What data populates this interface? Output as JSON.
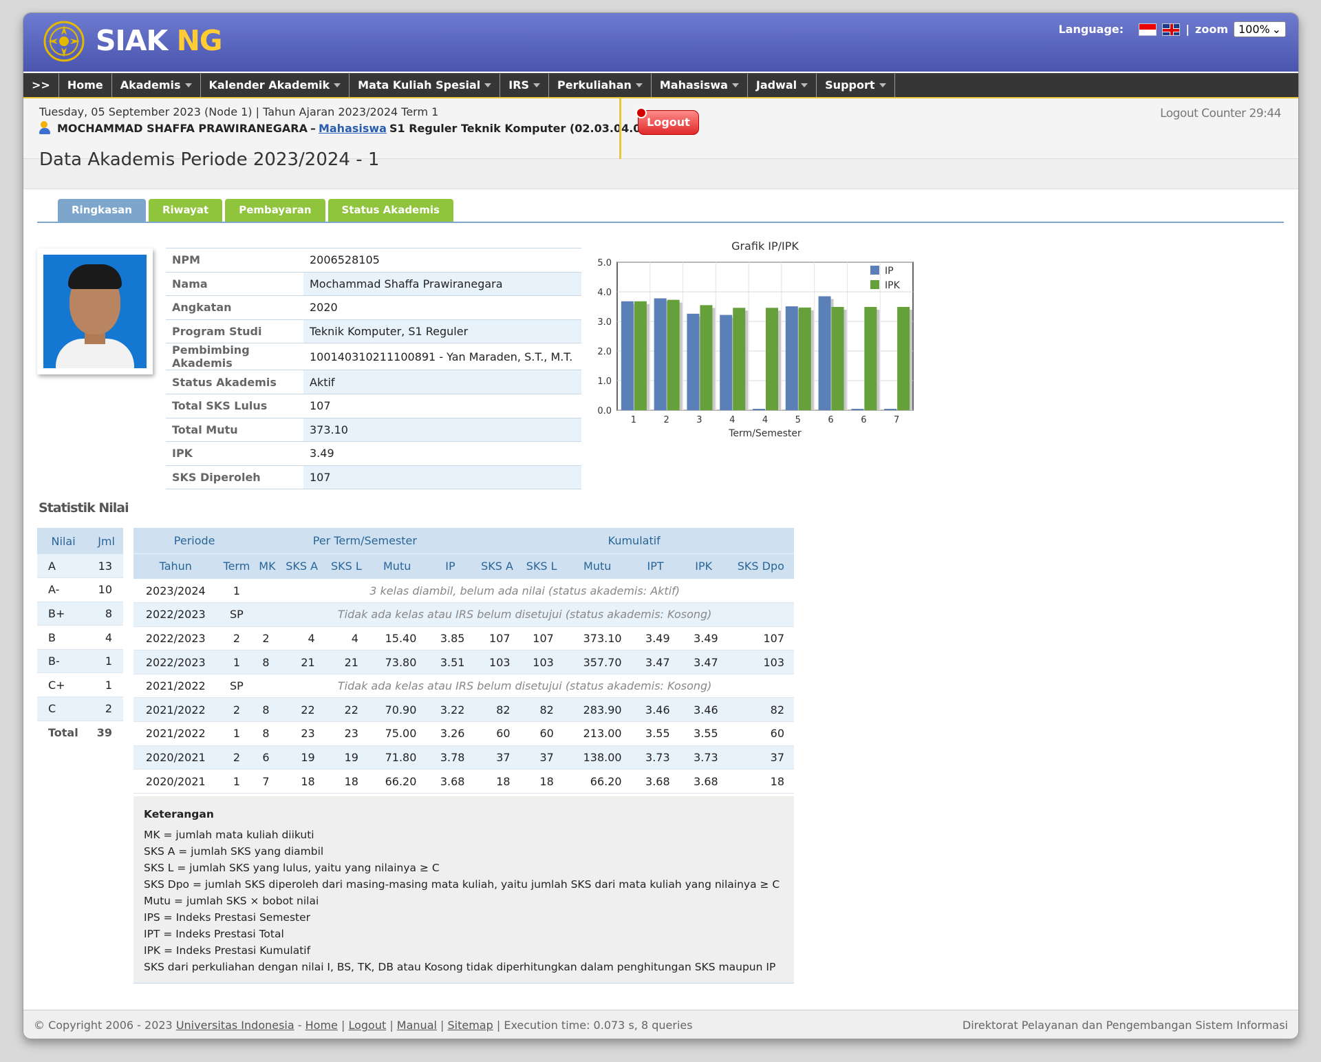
{
  "header": {
    "logo_main": "SIAK",
    "logo_accent": "NG",
    "language_label": "Language:",
    "zoom_label": "zoom",
    "zoom_value": "100%"
  },
  "menu": [
    {
      "label": ">>",
      "dropdown": false
    },
    {
      "label": "Home",
      "dropdown": false
    },
    {
      "label": "Akademis",
      "dropdown": true
    },
    {
      "label": "Kalender Akademik",
      "dropdown": true
    },
    {
      "label": "Mata Kuliah Spesial",
      "dropdown": true
    },
    {
      "label": "IRS",
      "dropdown": true
    },
    {
      "label": "Perkuliahan",
      "dropdown": true
    },
    {
      "label": "Mahasiswa",
      "dropdown": true
    },
    {
      "label": "Jadwal",
      "dropdown": true
    },
    {
      "label": "Support",
      "dropdown": true
    }
  ],
  "session": {
    "date_line": "Tuesday, 05 September 2023 (Node 1) | Tahun Ajaran 2023/2024 Term 1",
    "user_name": "MOCHAMMAD SHAFFA PRAWIRANEGARA",
    "separator": "–",
    "role_link": "Mahasiswa",
    "program": "S1 Reguler Teknik Komputer (02.03.04.01)",
    "logout_label": "Logout",
    "logout_counter": "Logout Counter 29:44"
  },
  "page_title": "Data Akademis Periode 2023/2024 - 1",
  "tabs": [
    "Ringkasan",
    "Riwayat",
    "Pembayaran",
    "Status Akademis"
  ],
  "profile": [
    {
      "key": "NPM",
      "value": "2006528105"
    },
    {
      "key": "Nama",
      "value": "Mochammad Shaffa Prawiranegara"
    },
    {
      "key": "Angkatan",
      "value": "2020"
    },
    {
      "key": "Program Studi",
      "value": "Teknik Komputer, S1 Reguler"
    },
    {
      "key": "Pembimbing Akademis",
      "value": "100140310211100891 - Yan Maraden, S.T., M.T."
    },
    {
      "key": "Status Akademis",
      "value": "Aktif"
    },
    {
      "key": "Total SKS Lulus",
      "value": "107"
    },
    {
      "key": "Total Mutu",
      "value": "373.10"
    },
    {
      "key": "IPK",
      "value": "3.49"
    },
    {
      "key": "SKS Diperoleh",
      "value": "107"
    }
  ],
  "chart_data": {
    "type": "bar",
    "title": "Grafik IP/IPK",
    "xlabel": "Term/Semester",
    "ylabel": "",
    "ylim": [
      0,
      5
    ],
    "yticks": [
      "0.0",
      "1.0",
      "2.0",
      "3.0",
      "4.0",
      "5.0"
    ],
    "categories": [
      "1",
      "2",
      "3",
      "4",
      "4",
      "5",
      "6",
      "6",
      "7"
    ],
    "series": [
      {
        "name": "IP",
        "color": "#5b80b8",
        "values": [
          3.68,
          3.78,
          3.26,
          3.22,
          0,
          3.51,
          3.85,
          0,
          0
        ]
      },
      {
        "name": "IPK",
        "color": "#66a03a",
        "values": [
          3.68,
          3.73,
          3.55,
          3.46,
          3.46,
          3.47,
          3.49,
          3.49,
          3.49
        ]
      }
    ],
    "legend": "top-right",
    "grid": true
  },
  "statistik": {
    "title": "Statistik Nilai",
    "nilai_headers": [
      "Nilai",
      "Jml"
    ],
    "nilai_rows": [
      {
        "nilai": "A",
        "jml": "13"
      },
      {
        "nilai": "A-",
        "jml": "10"
      },
      {
        "nilai": "B+",
        "jml": "8"
      },
      {
        "nilai": "B",
        "jml": "4"
      },
      {
        "nilai": "B-",
        "jml": "1"
      },
      {
        "nilai": "C+",
        "jml": "1"
      },
      {
        "nilai": "C",
        "jml": "2"
      }
    ],
    "nilai_total_label": "Total",
    "nilai_total": "39",
    "group_headers": [
      "Periode",
      "Per Term/Semester",
      "Kumulatif"
    ],
    "col_headers": [
      "Tahun",
      "Term",
      "MK",
      "SKS A",
      "SKS L",
      "Mutu",
      "IP",
      "SKS A",
      "SKS L",
      "Mutu",
      "IPT",
      "IPK",
      "SKS Dpo"
    ],
    "rows": [
      {
        "tahun": "2023/2024",
        "term": "1",
        "note": "3 kelas diambil, belum ada nilai (status akademis: Aktif)"
      },
      {
        "tahun": "2022/2023",
        "term": "SP",
        "note": "Tidak ada kelas atau IRS belum disetujui (status akademis: Kosong)"
      },
      {
        "tahun": "2022/2023",
        "term": "2",
        "cells": [
          "2",
          "4",
          "4",
          "15.40",
          "3.85",
          "107",
          "107",
          "373.10",
          "3.49",
          "3.49",
          "107"
        ]
      },
      {
        "tahun": "2022/2023",
        "term": "1",
        "cells": [
          "8",
          "21",
          "21",
          "73.80",
          "3.51",
          "103",
          "103",
          "357.70",
          "3.47",
          "3.47",
          "103"
        ]
      },
      {
        "tahun": "2021/2022",
        "term": "SP",
        "note": "Tidak ada kelas atau IRS belum disetujui (status akademis: Kosong)"
      },
      {
        "tahun": "2021/2022",
        "term": "2",
        "cells": [
          "8",
          "22",
          "22",
          "70.90",
          "3.22",
          "82",
          "82",
          "283.90",
          "3.46",
          "3.46",
          "82"
        ]
      },
      {
        "tahun": "2021/2022",
        "term": "1",
        "cells": [
          "8",
          "23",
          "23",
          "75.00",
          "3.26",
          "60",
          "60",
          "213.00",
          "3.55",
          "3.55",
          "60"
        ]
      },
      {
        "tahun": "2020/2021",
        "term": "2",
        "cells": [
          "6",
          "19",
          "19",
          "71.80",
          "3.78",
          "37",
          "37",
          "138.00",
          "3.73",
          "3.73",
          "37"
        ]
      },
      {
        "tahun": "2020/2021",
        "term": "1",
        "cells": [
          "7",
          "18",
          "18",
          "66.20",
          "3.68",
          "18",
          "18",
          "66.20",
          "3.68",
          "3.68",
          "18"
        ]
      }
    ]
  },
  "keterangan": {
    "title": "Keterangan",
    "lines": [
      "MK = jumlah mata kuliah diikuti",
      "SKS A = jumlah SKS yang diambil",
      "SKS L = jumlah SKS yang lulus, yaitu yang nilainya ≥ C",
      "SKS Dpo = jumlah SKS diperoleh dari masing-masing mata kuliah, yaitu jumlah SKS dari mata kuliah yang nilainya ≥ C",
      "Mutu = jumlah SKS × bobot nilai",
      "IPS = Indeks Prestasi Semester",
      "IPT = Indeks Prestasi Total",
      "IPK = Indeks Prestasi Kumulatif",
      "SKS dari perkuliahan dengan nilai I, BS, TK, DB atau Kosong tidak diperhitungkan dalam penghitungan SKS maupun IP"
    ]
  },
  "footer": {
    "copyright": "© Copyright 2006 - 2023",
    "university": "Universitas Indonesia",
    "dash": "-",
    "links": [
      "Home",
      "Logout",
      "Manual",
      "Sitemap"
    ],
    "exec": "Execution time: 0.073 s, 8 queries",
    "right": "Direktorat Pelayanan dan Pengembangan Sistem Informasi"
  }
}
